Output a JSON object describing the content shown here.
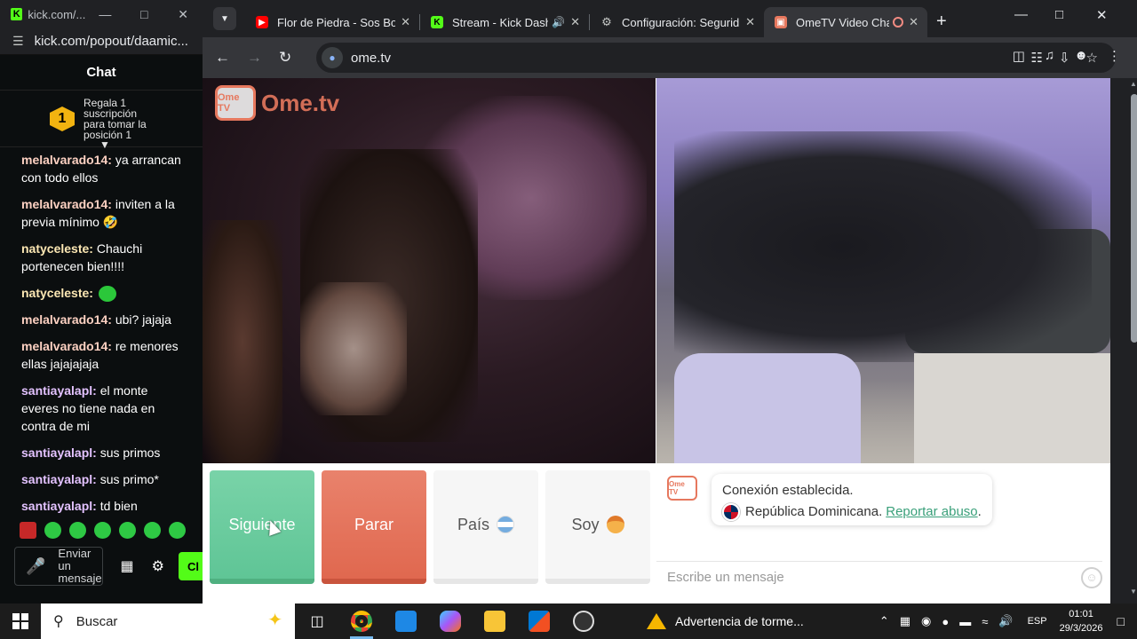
{
  "kick_window": {
    "tab_title": "kick.com/...",
    "url": "kick.com/popout/daamic...",
    "chat_header": "Chat",
    "pinned": {
      "badge_number": "1",
      "line1": "Regala 1",
      "line2": "suscripción",
      "line3": "para tomar la",
      "line4": "posición 1"
    },
    "messages": [
      {
        "user": "melalvarado14:",
        "text": " ya arrancan con todo ellos",
        "color": "#fdd1c2"
      },
      {
        "user": "melalvarado14:",
        "text": " inviten a la previa mínimo 🤣",
        "color": "#fdd1c2"
      },
      {
        "user": "natyceleste:",
        "text": " Chauchi portenecen bien!!!!",
        "color": "#fce7b3"
      },
      {
        "user": "natyceleste:",
        "text": "",
        "color": "#fce7b3",
        "emote": true
      },
      {
        "user": "melalvarado14:",
        "text": " ubi? jajaja",
        "color": "#fdd1c2"
      },
      {
        "user": "melalvarado14:",
        "text": " re menores ellas jajajajaja",
        "color": "#fdd1c2"
      },
      {
        "user": "santiayalapl:",
        "text": " el monte everes no tiene nada en contra de mi",
        "color": "#e3c2ff"
      },
      {
        "user": "santiayalapl:",
        "text": " sus primos",
        "color": "#e3c2ff"
      },
      {
        "user": "santiayalapl:",
        "text": " sus primo*",
        "color": "#e3c2ff"
      },
      {
        "user": "santiayalapl:",
        "text": " td bien",
        "color": "#e3c2ff"
      }
    ],
    "input_placeholder": "Enviar un mensaje",
    "chat_button": "Cl"
  },
  "browser": {
    "tabs": [
      {
        "label": "Flor de Piedra - Sos Bot",
        "favicon_color": "#ff0000",
        "active": false
      },
      {
        "label": "Stream - Kick Dashb",
        "favicon_color": "#53fc18",
        "active": false,
        "sound": true
      },
      {
        "label": "Configuración: Segurid",
        "favicon_color": "#9aa0a6",
        "active": false
      },
      {
        "label": "OmeTV Video Chat",
        "favicon_color": "#e6785e",
        "active": true,
        "recording": true
      }
    ],
    "url": "ome.tv"
  },
  "ometv": {
    "logo_text": "Ome.tv",
    "logo_badge": "Ome TV",
    "buttons": {
      "next": "Siguiente",
      "stop": "Parar",
      "country": "País",
      "gender": "Soy"
    },
    "chat": {
      "line1": "Conexión establecida.",
      "country": "República Dominicana.",
      "report": "Reportar abuso",
      "report_tail": ".",
      "input_placeholder": "Escribe un mensaje"
    }
  },
  "taskbar": {
    "search_placeholder": "Buscar",
    "weather_text": "Advertencia de torme...",
    "lang": "ESP",
    "time": "01:01",
    "date": "29/3/2026"
  }
}
